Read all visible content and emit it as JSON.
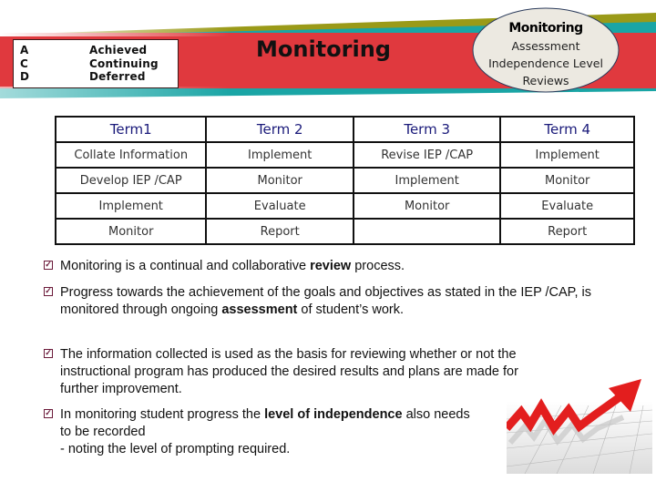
{
  "banner": {
    "title": "Monitoring",
    "colors": {
      "band": "#e0393e",
      "olive": "#9a9a18",
      "teal": "#1aa5a5",
      "oval": "#ece9e1"
    },
    "legend": [
      {
        "code": "A",
        "meaning": "Achieved"
      },
      {
        "code": "C",
        "meaning": "Continuing"
      },
      {
        "code": "D",
        "meaning": "Deferred"
      }
    ],
    "oval": {
      "title": "Monitoring",
      "lines": [
        "Assessment",
        "Independence Level",
        "Reviews"
      ]
    }
  },
  "terms_table": {
    "headers": [
      "Term1",
      "Term 2",
      "Term 3",
      "Term 4"
    ],
    "rows": [
      [
        "Collate Information",
        "Implement",
        "Revise IEP /CAP",
        "Implement"
      ],
      [
        "Develop IEP /CAP",
        "Monitor",
        "Implement",
        "Monitor"
      ],
      [
        "Implement",
        "Evaluate",
        "Monitor",
        "Evaluate"
      ],
      [
        "Monitor",
        "Report",
        "",
        "Report"
      ]
    ]
  },
  "bullets": [
    {
      "pre": "Monitoring is a continual and collaborative ",
      "bold": "review",
      "post": " process."
    },
    {
      "pre": "Progress towards the achievement of the goals and objectives as stated in the IEP /CAP, is monitored through ongoing ",
      "bold": "assessment",
      "post": " of student’s work."
    },
    {
      "pre": "The information collected is used as the basis  for reviewing whether or not the instructional program has produced the desired results and plans are made for further improvement.",
      "bold": "",
      "post": ""
    },
    {
      "pre": "In monitoring student progress the ",
      "bold": "level of independence",
      "post": " also needs to be recorded",
      "extra": " - noting the level of prompting required."
    }
  ],
  "bullet_icon": "checked-box-icon",
  "image": {
    "icon": "rising-arrow-chart-icon"
  }
}
